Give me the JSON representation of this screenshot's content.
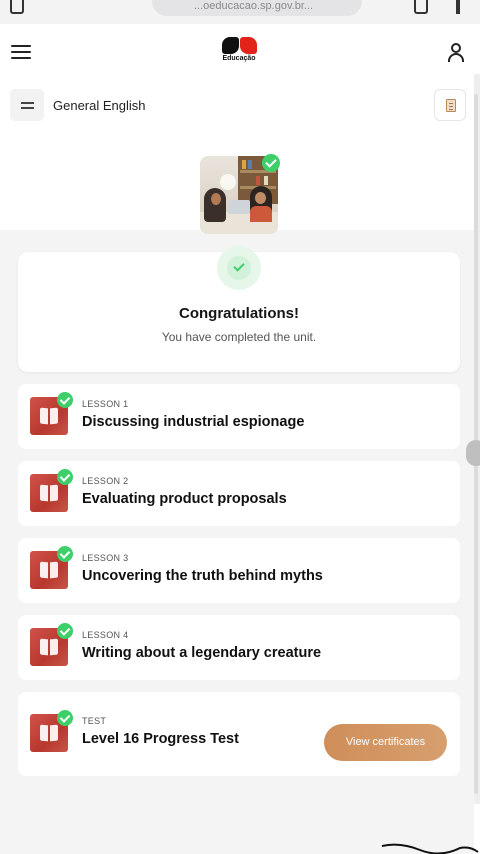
{
  "browser": {
    "url": "...oeducacao.sp.gov.br..."
  },
  "header": {
    "logo_text": "Educação"
  },
  "course": {
    "title": "General English"
  },
  "congrats": {
    "title": "Congratulations!",
    "subtitle": "You have completed the unit."
  },
  "lessons": [
    {
      "label": "LESSON 1",
      "title": "Discussing industrial espionage",
      "completed": true
    },
    {
      "label": "LESSON 2",
      "title": "Evaluating product proposals",
      "completed": true
    },
    {
      "label": "LESSON 3",
      "title": "Uncovering the truth behind myths",
      "completed": true
    },
    {
      "label": "LESSON 4",
      "title": "Writing about a legendary creature",
      "completed": true
    }
  ],
  "test": {
    "label": "TEST",
    "title": "Level 16 Progress Test",
    "completed": true,
    "button_label": "View certificates"
  },
  "colors": {
    "accent": "#d79f6e",
    "check": "#3ecf6a",
    "logo_red": "#e2231a",
    "lesson_thumb": "#c7554a"
  },
  "icons": [
    "hamburger-icon",
    "user-icon",
    "menu-icon",
    "notebook-icon",
    "check-icon",
    "book-icon"
  ]
}
